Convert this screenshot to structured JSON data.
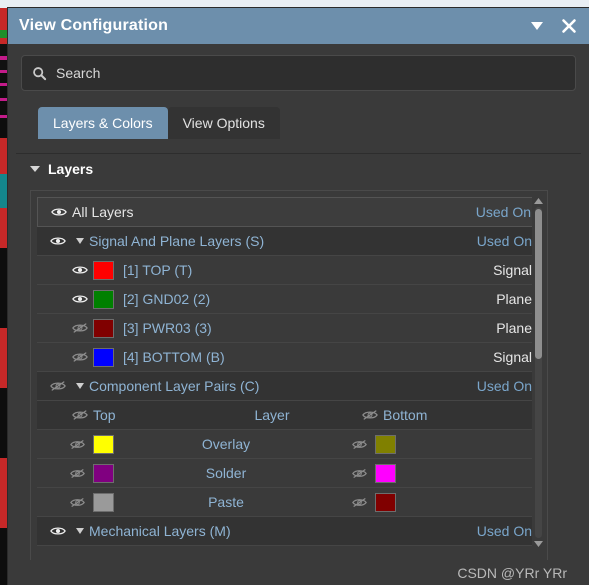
{
  "window": {
    "title": "View Configuration",
    "collapse_icon": "chevron-down-icon",
    "close_icon": "close-icon"
  },
  "search": {
    "icon": "search-icon",
    "placeholder": "Search",
    "value": ""
  },
  "tabs": [
    {
      "label": "Layers & Colors",
      "active": true
    },
    {
      "label": "View Options",
      "active": false
    }
  ],
  "section": {
    "title": "Layers",
    "expanded": true
  },
  "columns": {
    "pair_top": "Top",
    "pair_layer": "Layer",
    "pair_bottom": "Bottom"
  },
  "rows": [
    {
      "kind": "all",
      "label": "All Layers",
      "value": "Used On",
      "eye": "eye-visible-icon"
    },
    {
      "kind": "group",
      "label": "Signal And Plane Layers (S)",
      "value": "Used On",
      "eye": "eye-visible-icon",
      "expanded": true
    },
    {
      "kind": "leaf",
      "label": "[1] TOP (T)",
      "value": "Signal",
      "color": "#FF0000",
      "eye": "eye-visible-icon"
    },
    {
      "kind": "leaf",
      "label": "[2] GND02 (2)",
      "value": "Plane",
      "color": "#008000",
      "eye": "eye-visible-icon"
    },
    {
      "kind": "leaf",
      "label": "[3] PWR03 (3)",
      "value": "Plane",
      "color": "#800000",
      "eye": "eye-hidden-icon"
    },
    {
      "kind": "leaf",
      "label": "[4] BOTTOM (B)",
      "value": "Signal",
      "color": "#0000FF",
      "eye": "eye-hidden-icon"
    },
    {
      "kind": "group",
      "label": "Component Layer Pairs (C)",
      "value": "Used On",
      "eye": "eye-hidden-icon",
      "expanded": true
    }
  ],
  "pair_header": {
    "eye_top": "eye-hidden-icon",
    "eye_bottom": "eye-hidden-icon"
  },
  "pairs": [
    {
      "label": "Overlay",
      "top_color": "#FFFF00",
      "bottom_color": "#808000",
      "top_eye": "eye-hidden-icon",
      "bottom_eye": "eye-hidden-icon"
    },
    {
      "label": "Solder",
      "top_color": "#800080",
      "bottom_color": "#FF00FF",
      "top_eye": "eye-hidden-icon",
      "bottom_eye": "eye-hidden-icon"
    },
    {
      "label": "Paste",
      "top_color": "#9A9A9A",
      "bottom_color": "#800000",
      "top_eye": "eye-hidden-icon",
      "bottom_eye": "eye-hidden-icon"
    }
  ],
  "last_row": {
    "kind": "group",
    "label": "Mechanical Layers (M)",
    "value": "Used On",
    "eye": "eye-visible-icon",
    "expanded": true
  },
  "scrollbar": {
    "up_icon": "triangle-up-icon",
    "down_icon": "triangle-down-icon"
  },
  "watermark": "CSDN @YRr YRr",
  "colors": {
    "titlebar": "#6d8fac",
    "dialog_bg": "#3a3a3a",
    "accent": "#6d8fac",
    "used_on_text": "#7aa6cb",
    "label_blue": "#8fb4d4"
  }
}
